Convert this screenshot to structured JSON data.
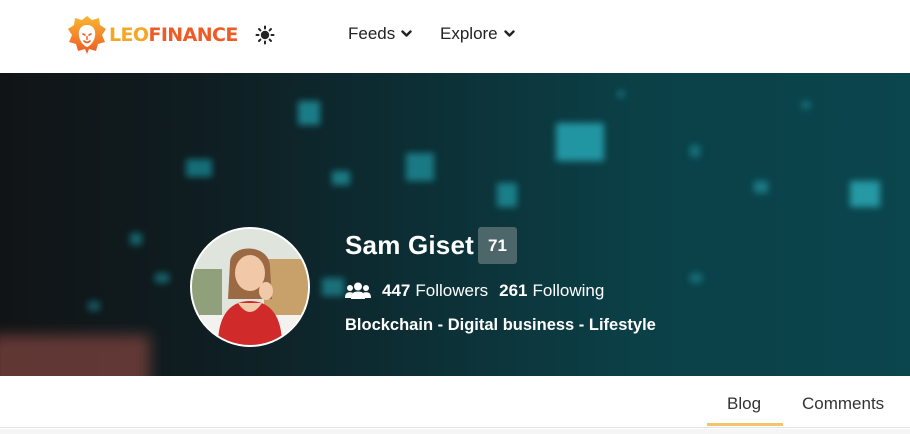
{
  "header": {
    "logo": {
      "text_part1": "LEO",
      "text_part2": "FINANCE",
      "color_gold": "#f5a623",
      "color_orange": "#ef5b25"
    },
    "theme_toggle_icon": "sun-icon",
    "nav": [
      {
        "label": "Feeds",
        "icon": "chevron-down-icon"
      },
      {
        "label": "Explore",
        "icon": "chevron-down-icon"
      }
    ]
  },
  "profile": {
    "name": "Sam Giset",
    "reputation": "71",
    "followers_count": "447",
    "followers_label": "Followers",
    "following_count": "261",
    "following_label": "Following",
    "about": "Blockchain - Digital business - Lifestyle",
    "avatar_icon": "avatar",
    "followers_icon": "users-icon"
  },
  "tabs": [
    {
      "label": "Blog",
      "active": true
    },
    {
      "label": "Comments",
      "active": false
    }
  ],
  "colors": {
    "accent": "#f2c46e",
    "badge": "#4d6669",
    "banner_teal": "#0b454d"
  }
}
